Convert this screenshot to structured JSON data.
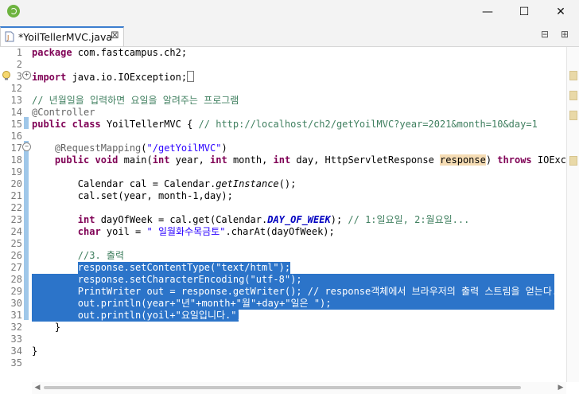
{
  "window": {
    "minimize": "—",
    "maximize": "☐",
    "close": "✕"
  },
  "tab": {
    "title": "*YoilTellerMVC.java",
    "close": "⊠"
  },
  "view": {
    "minimize": "⊟",
    "maximize": "⊞"
  },
  "lines": [
    {
      "n": "1",
      "html": "<span class=\"kw\">package</span> com.fastcampus.ch2;"
    },
    {
      "n": "2",
      "html": ""
    },
    {
      "n": "3",
      "html": "<span class=\"kw\">import</span> java.io.IOException;<span style=\"display:inline-block;width:7px;height:12px;border:1px solid #777;vertical-align:-2px\"></span>"
    },
    {
      "n": "12",
      "html": ""
    },
    {
      "n": "13",
      "html": "<span class=\"cm\">// 년월일을 입력하면 요일을 알려주는 프로그램</span>"
    },
    {
      "n": "14",
      "html": "<span class=\"an\">@Controller</span>"
    },
    {
      "n": "15",
      "html": "<span class=\"kw\">public</span> <span class=\"kw\">class</span> YoilTellerMVC { <span class=\"cm\">// http://localhost/ch2/getYoilMVC?year=2021&amp;month=10&amp;day=1</span>"
    },
    {
      "n": "16",
      "html": ""
    },
    {
      "n": "17",
      "html": "    <span class=\"an\">@RequestMapping</span>(<span class=\"st\">\"/getYoilMVC\"</span>)"
    },
    {
      "n": "18",
      "html": "    <span class=\"kw\">public</span> <span class=\"kw\">void</span> main(<span class=\"kw\">int</span> year, <span class=\"kw\">int</span> month, <span class=\"kw\">int</span> day, HttpServletResponse <span class=\"hl\">response</span>) <span class=\"kw\">throws</span> IOExce"
    },
    {
      "n": "19",
      "html": ""
    },
    {
      "n": "20",
      "html": "        Calendar cal = Calendar.<span class=\"ital\">getInstance</span>();"
    },
    {
      "n": "21",
      "html": "        cal.set(year, month-1,day);"
    },
    {
      "n": "22",
      "html": ""
    },
    {
      "n": "23",
      "html": "        <span class=\"kw\">int</span> dayOfWeek = cal.get(Calendar.<span class=\"fd ital\" style=\"font-weight:bold\">DAY_OF_WEEK</span>); <span class=\"cm\">// 1:일요일, 2:월요일...</span>"
    },
    {
      "n": "24",
      "html": "        <span class=\"kw\">char</span> yoil = <span class=\"st\">\" 일월화수목금토\"</span>.charAt(dayOfWeek);"
    },
    {
      "n": "25",
      "html": ""
    },
    {
      "n": "26",
      "html": "        <span class=\"cm\">//3. 출력</span>"
    },
    {
      "n": "27",
      "html": "        <span class=\"sel\">response.setContentType(\"text/html\");</span>",
      "sel": "partial"
    },
    {
      "n": "28",
      "html": "<span class=\"sel\">        response.setCharacterEncoding(\"utf-8\");</span>",
      "sel": "full"
    },
    {
      "n": "29",
      "html": "<span class=\"sel\">        PrintWriter out = response.getWriter(); // response객체에서 브라우저의 출력 스트림을 얻는다.</span>",
      "sel": "full"
    },
    {
      "n": "30",
      "html": "<span class=\"sel\">        out.println(year+\"년\"+month+\"월\"+day+\"일은 \");</span>",
      "sel": "full"
    },
    {
      "n": "31",
      "html": "<span class=\"sel\">        out.println(yoil+\"요일입니다.\");</span>",
      "sel": "last"
    },
    {
      "n": "32",
      "html": "    }"
    },
    {
      "n": "33",
      "html": ""
    },
    {
      "n": "34",
      "html": "}"
    },
    {
      "n": "35",
      "html": ""
    }
  ]
}
